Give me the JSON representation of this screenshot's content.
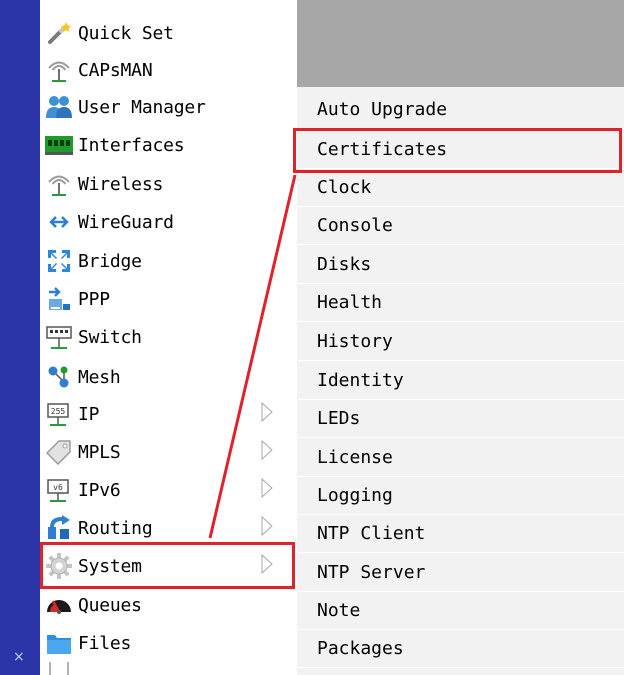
{
  "left_menu": {
    "items": [
      {
        "label": "Quick Set",
        "icon": "wand-icon",
        "has_submenu": false
      },
      {
        "label": "CAPsMAN",
        "icon": "antenna-icon",
        "has_submenu": false
      },
      {
        "label": "User Manager",
        "icon": "users-icon",
        "has_submenu": false
      },
      {
        "label": "Interfaces",
        "icon": "interfaces-icon",
        "has_submenu": false
      },
      {
        "label": "Wireless",
        "icon": "antenna-icon",
        "has_submenu": false
      },
      {
        "label": "WireGuard",
        "icon": "arrows-icon",
        "has_submenu": false
      },
      {
        "label": "Bridge",
        "icon": "bridge-icon",
        "has_submenu": false
      },
      {
        "label": "PPP",
        "icon": "ppp-icon",
        "has_submenu": false
      },
      {
        "label": "Switch",
        "icon": "switch-icon",
        "has_submenu": false
      },
      {
        "label": "Mesh",
        "icon": "mesh-icon",
        "has_submenu": false
      },
      {
        "label": "IP",
        "icon": "ip-icon",
        "has_submenu": true
      },
      {
        "label": "MPLS",
        "icon": "mpls-icon",
        "has_submenu": true
      },
      {
        "label": "IPv6",
        "icon": "ipv6-icon",
        "has_submenu": true
      },
      {
        "label": "Routing",
        "icon": "routing-icon",
        "has_submenu": true
      },
      {
        "label": "System",
        "icon": "gear-icon",
        "has_submenu": true,
        "highlighted": true
      },
      {
        "label": "Queues",
        "icon": "queues-icon",
        "has_submenu": false
      },
      {
        "label": "Files",
        "icon": "folder-icon",
        "has_submenu": false
      }
    ]
  },
  "sub_menu": {
    "items": [
      {
        "label": "Auto Upgrade"
      },
      {
        "label": "Certificates",
        "highlighted": true
      },
      {
        "label": "Clock"
      },
      {
        "label": "Console"
      },
      {
        "label": "Disks"
      },
      {
        "label": "Health"
      },
      {
        "label": "History"
      },
      {
        "label": "Identity"
      },
      {
        "label": "LEDs"
      },
      {
        "label": "License"
      },
      {
        "label": "Logging"
      },
      {
        "label": "NTP Client"
      },
      {
        "label": "NTP Server"
      },
      {
        "label": "Note"
      },
      {
        "label": "Packages"
      }
    ]
  },
  "vertical_strip": {
    "close_glyph": "×"
  },
  "colors": {
    "highlight_red": "#e0232b",
    "strip_blue": "#2b35a8",
    "submenu_bg": "#f2f2f2",
    "topbar_gray": "#a7a7a7"
  }
}
